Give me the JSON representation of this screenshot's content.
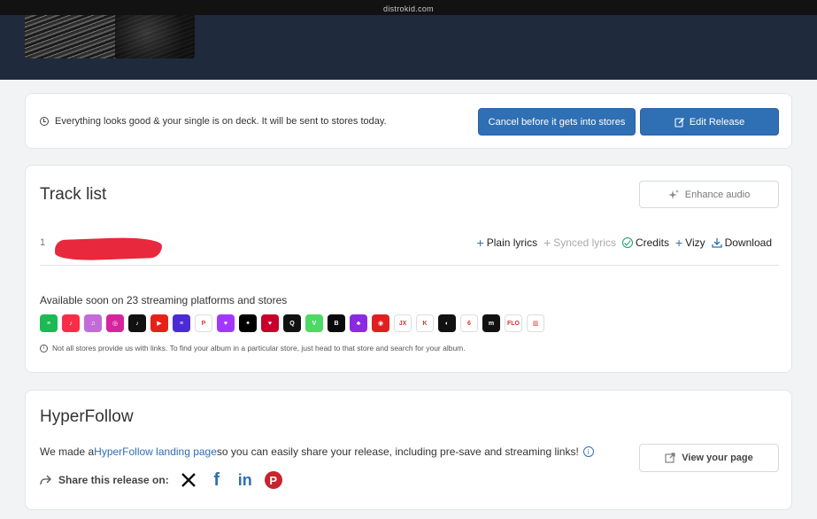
{
  "browser": {
    "url": "distrokid.com"
  },
  "notice": {
    "message": "Everything looks good & your single is on deck. It will be sent to stores today.",
    "cancel_label": "Cancel before it gets into stores",
    "edit_label": "Edit Release"
  },
  "tracklist": {
    "title": "Track list",
    "enhance_label": "Enhance audio",
    "track_number": "1",
    "actions": {
      "plain_lyrics": "Plain lyrics",
      "synced_lyrics": "Synced lyrics",
      "credits": "Credits",
      "vizy": "Vizy",
      "download": "Download"
    },
    "available_text": "Available soon on 23 streaming platforms and stores",
    "disclaimer": "Not all stores provide us with links. To find your album in a particular store, just head to that store and search for your album."
  },
  "stores": [
    {
      "name": "spotify-icon",
      "color": "#1db954",
      "glyph": "≡"
    },
    {
      "name": "apple-music-icon",
      "color": "#fa2d48",
      "glyph": "♪"
    },
    {
      "name": "itunes-icon",
      "color": "#c36bd9",
      "glyph": "♫"
    },
    {
      "name": "instagram-icon",
      "color": "#d6249f",
      "glyph": "◎"
    },
    {
      "name": "tiktok-icon",
      "color": "#111111",
      "glyph": "♪"
    },
    {
      "name": "youtube-music-icon",
      "color": "#e62117",
      "glyph": "▶"
    },
    {
      "name": "amazon-music-icon",
      "color": "#4b2bd6",
      "glyph": "≡"
    },
    {
      "name": "pandora-icon",
      "color": "#ffffff",
      "glyph": "P"
    },
    {
      "name": "deezer-icon",
      "color": "#a238ff",
      "glyph": "♥"
    },
    {
      "name": "tidal-icon",
      "color": "#000000",
      "glyph": "✦"
    },
    {
      "name": "iheartradio-icon",
      "color": "#c6002b",
      "glyph": "♥"
    },
    {
      "name": "qobuz-icon",
      "color": "#111111",
      "glyph": "Q"
    },
    {
      "name": "vk-music-icon",
      "color": "#4cd964",
      "glyph": "V"
    },
    {
      "name": "boomplay-icon",
      "color": "#0a0a0a",
      "glyph": "B"
    },
    {
      "name": "anghami-icon",
      "color": "#8a2be2",
      "glyph": "♣"
    },
    {
      "name": "netease-icon",
      "color": "#e02020",
      "glyph": "◉"
    },
    {
      "name": "joox-icon",
      "color": "#ffffff",
      "glyph": "JX"
    },
    {
      "name": "kkbox-icon",
      "color": "#ffffff",
      "glyph": "K"
    },
    {
      "name": "audiomack-icon",
      "color": "#111111",
      "glyph": "◐"
    },
    {
      "name": "audius-icon",
      "color": "#ffffff",
      "glyph": "6"
    },
    {
      "name": "melon-icon",
      "color": "#111111",
      "glyph": "m"
    },
    {
      "name": "flo-icon",
      "color": "#ffffff",
      "glyph": "FLO"
    },
    {
      "name": "jiosaavn-icon",
      "color": "#ffffff",
      "glyph": "▥"
    }
  ],
  "hyperfollow": {
    "title": "HyperFollow",
    "text_before": "We made a ",
    "link_text": "HyperFollow landing page",
    "text_after": " so you can easily share your release, including pre-save and streaming links!",
    "view_label": "View your page",
    "share_label": "Share this release on:"
  }
}
